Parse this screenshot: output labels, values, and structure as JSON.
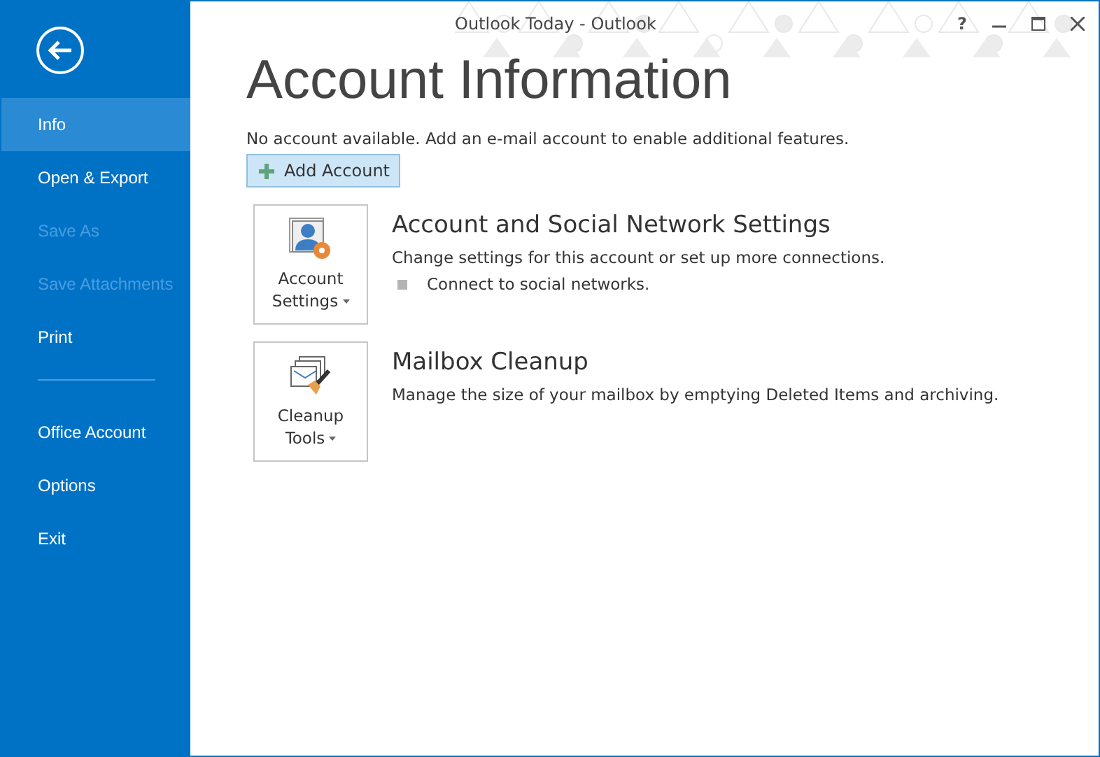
{
  "window": {
    "title": "Outlook Today - Outlook",
    "help": "?"
  },
  "sidebar": {
    "items": [
      {
        "kind": "item",
        "label": "Info",
        "selected": true,
        "disabled": false
      },
      {
        "kind": "item",
        "label": "Open & Export",
        "selected": false,
        "disabled": false
      },
      {
        "kind": "item",
        "label": "Save As",
        "selected": false,
        "disabled": true
      },
      {
        "kind": "item",
        "label": "Save Attachments",
        "selected": false,
        "disabled": true
      },
      {
        "kind": "item",
        "label": "Print",
        "selected": false,
        "disabled": false
      },
      {
        "kind": "divider"
      },
      {
        "kind": "item",
        "label": "Office Account",
        "selected": false,
        "disabled": false
      },
      {
        "kind": "item",
        "label": "Options",
        "selected": false,
        "disabled": false
      },
      {
        "kind": "item",
        "label": "Exit",
        "selected": false,
        "disabled": false
      }
    ]
  },
  "heading": "Account Information",
  "notice": "No account available. Add an e-mail account to enable additional features.",
  "add_button": "Add Account",
  "sections": [
    {
      "kind": "account",
      "tile_lines": [
        "Account",
        "Settings"
      ],
      "title": "Account and Social Network Settings",
      "description": "Change settings for this account or set up more connections.",
      "bullets": [
        "Connect to social networks."
      ]
    },
    {
      "kind": "cleanup",
      "tile_lines": [
        "Cleanup",
        "Tools"
      ],
      "title": "Mailbox Cleanup",
      "description": "Manage the size of your mailbox by emptying Deleted Items and archiving."
    }
  ]
}
